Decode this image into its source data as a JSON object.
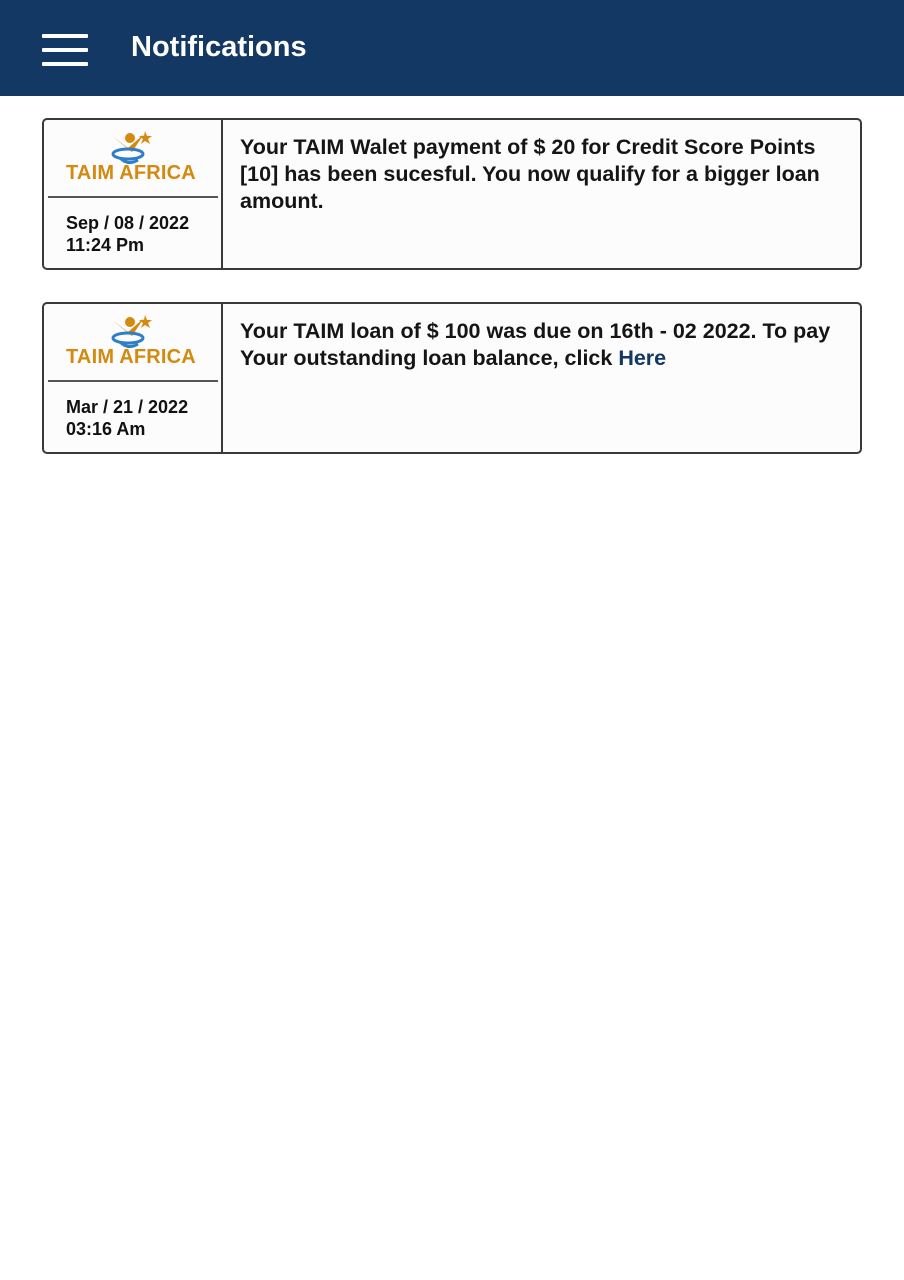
{
  "header": {
    "menu_icon": "hamburger-menu-icon",
    "title": "Notifications"
  },
  "notifications": [
    {
      "logo_text": "TAIM AFRICA",
      "date": "Sep / 08 / 2022",
      "time": "11:24 Pm",
      "message": "Your TAIM Walet payment of $ 20 for Credit Score Points [10] has been sucesful. You now qualify for a bigger loan amount."
    },
    {
      "logo_text": "TAIM AFRICA",
      "date": "Mar / 21 / 2022",
      "time": "03:16 Am",
      "message": "Your TAIM loan of $ 100 was due on 16th - 02 2022. To pay Your outstanding loan balance, click ",
      "link_text": "Here"
    }
  ],
  "colors": {
    "header_bg": "#143864",
    "logo_orange": "#d4890f",
    "logo_blue": "#2f7fc8",
    "link": "#143864"
  }
}
